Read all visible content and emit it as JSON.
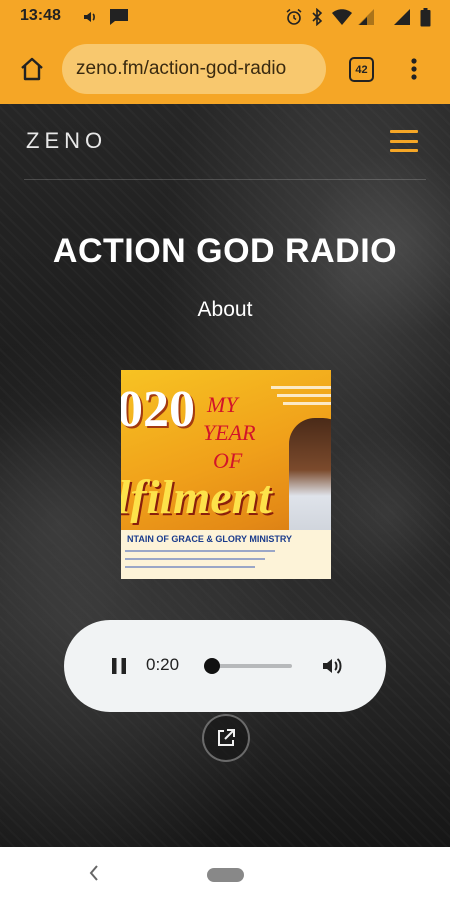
{
  "status_bar": {
    "time": "13:48",
    "left_icons": [
      "volume-icon",
      "message-icon"
    ],
    "right_icons": [
      "alarm-icon",
      "bluetooth-icon",
      "wifi-icon",
      "signal-icon",
      "signal-icon",
      "battery-icon"
    ]
  },
  "browser": {
    "url": "zeno.fm/action-god-radio",
    "tab_count": "42",
    "accent_color": "#f5a626"
  },
  "site": {
    "logo": "ZENO",
    "title": "ACTION GOD RADIO",
    "about_link": "About",
    "accent_color": "#f5a626"
  },
  "cover_art": {
    "year_text": "020",
    "line1": "MY",
    "line2": "YEAR",
    "line3": "OF",
    "headline": "lfilment",
    "ministry": "NTAIN OF GRACE & GLORY MINISTRY"
  },
  "player": {
    "state": "playing",
    "current_time": "0:20",
    "progress": 0.05
  }
}
